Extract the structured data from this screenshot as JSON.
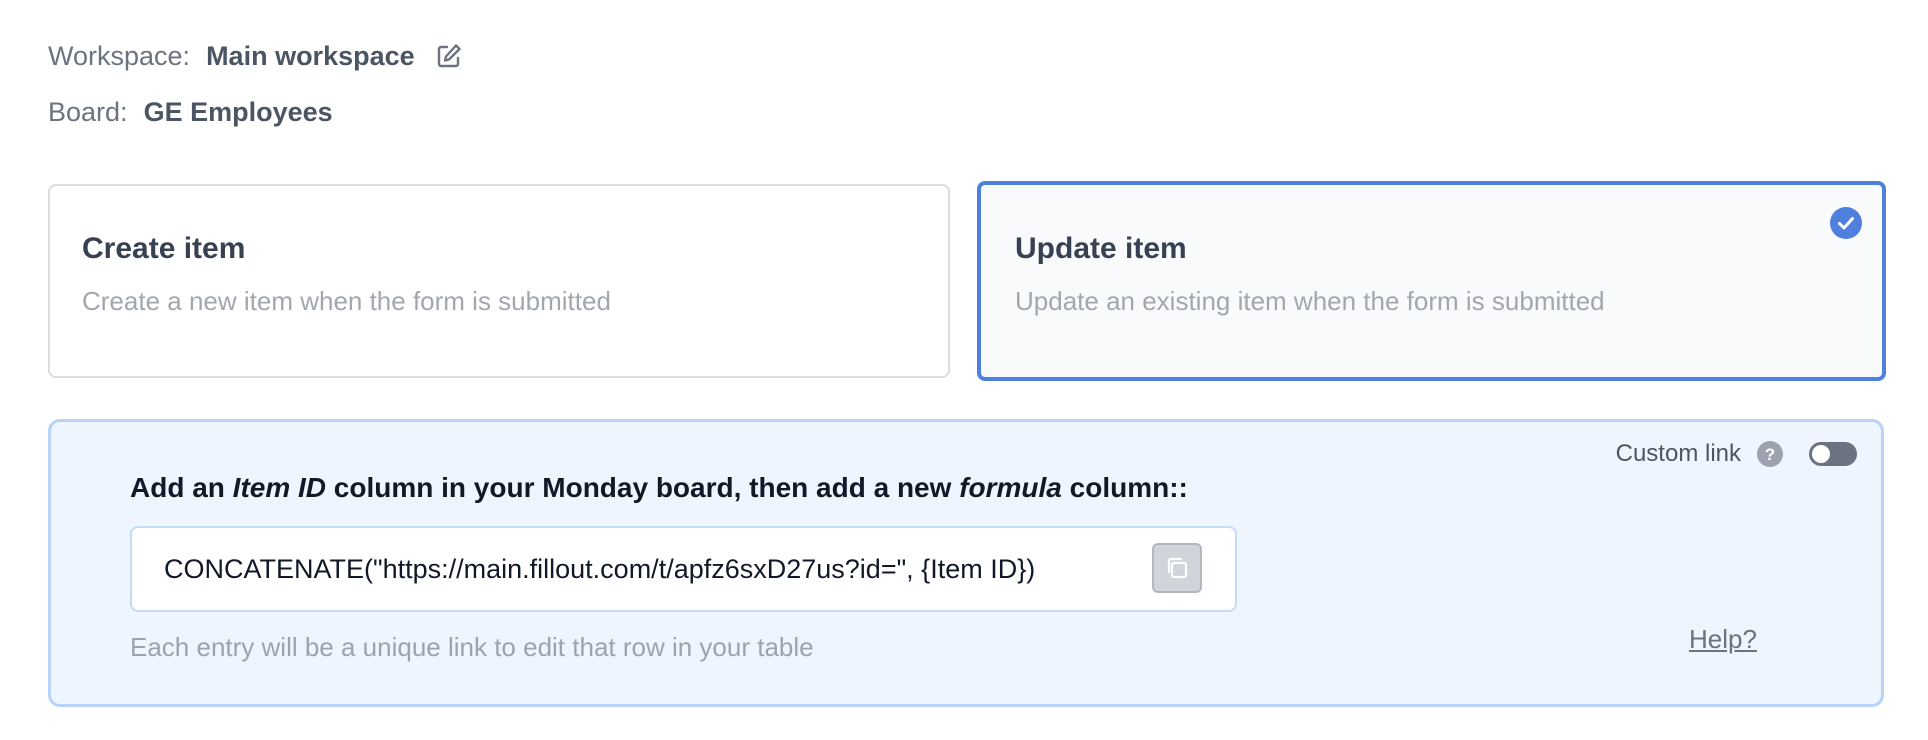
{
  "workspace": {
    "label": "Workspace:",
    "value": "Main workspace",
    "edit_icon": "edit-icon"
  },
  "board": {
    "label": "Board:",
    "value": "GE Employees"
  },
  "options": {
    "create": {
      "title": "Create item",
      "description": "Create a new item when the form is submitted",
      "selected": false
    },
    "update": {
      "title": "Update item",
      "description": "Update an existing item when the form is submitted",
      "selected": true,
      "selected_icon": "check-circle-icon"
    }
  },
  "panel": {
    "custom_link_label": "Custom link",
    "custom_link_enabled": false,
    "instruction_part1": "Add an ",
    "instruction_em1": "Item ID",
    "instruction_part2": " column in your Monday board, then add a new ",
    "instruction_em2": "formula",
    "instruction_part3": " column::",
    "formula": "CONCATENATE(\"https://main.fillout.com/t/apfz6sxD27us?id=\", {Item ID})",
    "footnote": "Each entry will be a unique link to edit that row in your table",
    "help_link": "Help?"
  },
  "colors": {
    "accent": "#4f7fdf",
    "panel_bg": "#eef5fe",
    "panel_border": "#b6d2f4"
  }
}
